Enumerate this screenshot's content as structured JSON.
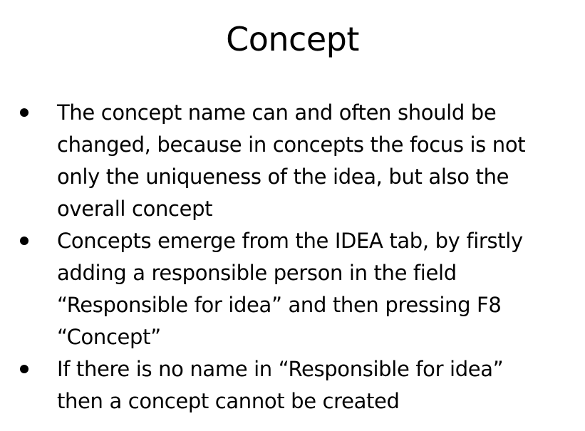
{
  "slide": {
    "title": "Concept",
    "bullets": [
      {
        "lines": [
          "The concept name can and often should be",
          "changed, because in concepts the focus is not",
          "only the uniqueness of the idea, but also the",
          "overall concept"
        ]
      },
      {
        "lines": [
          "Concepts emerge from the IDEA tab, by firstly",
          "adding a responsible person in the field",
          "“Responsible for idea”  and then pressing F8",
          "“Concept”"
        ]
      },
      {
        "lines": [
          "If there is no name in “Responsible for idea”",
          "then a concept cannot be created"
        ]
      }
    ]
  }
}
